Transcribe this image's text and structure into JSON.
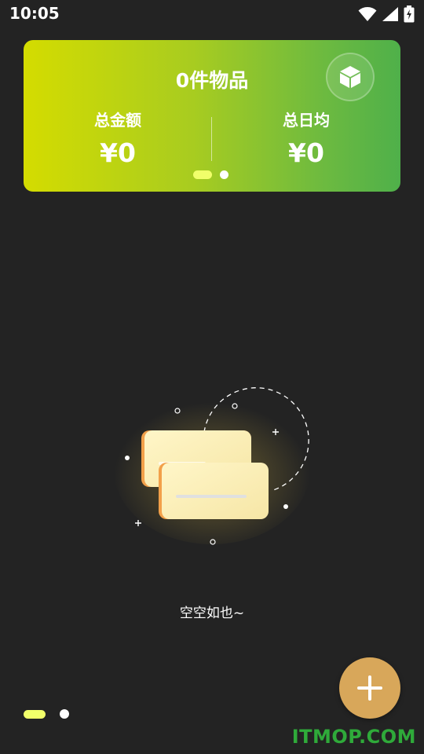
{
  "status_bar": {
    "time": "10:05",
    "icons": [
      "wifi-icon",
      "signal-icon",
      "battery-charging-icon"
    ]
  },
  "summary": {
    "item_count": "0件物品",
    "total_amount_label": "总金额",
    "total_amount_value": "¥0",
    "daily_avg_label": "总日均",
    "daily_avg_value": "¥0",
    "box_icon": "box-icon",
    "pager": {
      "count": 2,
      "active": 1
    }
  },
  "empty_state": {
    "message": "空空如也~",
    "illustration": "cards-illustration"
  },
  "page_indicator": {
    "count": 2,
    "active": 1
  },
  "fab": {
    "icon": "plus-icon"
  },
  "watermark": "ITMOP.COM",
  "colors": {
    "background": "#232323",
    "card_gradient_start": "#d4dc00",
    "card_gradient_end": "#4fb04a",
    "indicator_active": "#f1ff6a",
    "fab": "#d8a75a",
    "watermark": "#2faa3a"
  }
}
